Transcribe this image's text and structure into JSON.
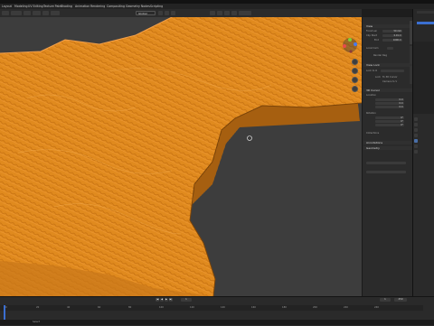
{
  "window_title": "",
  "menu": {
    "items": [
      "Layout",
      "Modeling",
      "UV Editing",
      "Texture Paint",
      "Shading",
      "Animation",
      "Rendering",
      "Compositing",
      "Geometry Nodes",
      "Scripting"
    ]
  },
  "header": {
    "mode_select": "Global"
  },
  "npanel": {
    "sections": {
      "view": "View",
      "focal_length": "Focal Len",
      "clip_start": "Clip Start",
      "clip_end": "End",
      "local_camera": "Local Cam",
      "render_region": "Render Reg",
      "view_lock": "View Lock",
      "lock_to_object": "Lock to O",
      "lock": "Lock",
      "lock_3d_cursor": "To 3D Cursor",
      "lock_camera": "Camera to V",
      "cursor_3d": "3D Cursor",
      "location": "Location",
      "rotation": "Rotation",
      "collections": "Collections",
      "annotations": "Annotations",
      "geometry": "Geometry"
    },
    "values": {
      "focal_length": "50 mm",
      "clip_start": "0.01 m",
      "clip_end": "1000 m",
      "cursor_x": "0 m",
      "cursor_y": "0 m",
      "cursor_z": "0 m",
      "rot_x": "0°",
      "rot_y": "0°",
      "rot_z": "0°"
    }
  },
  "timeline": {
    "ticks": [
      "0",
      "20",
      "40",
      "60",
      "80",
      "100",
      "120",
      "140",
      "160",
      "180",
      "200",
      "220",
      "240"
    ],
    "start": "1",
    "end": "250",
    "current": "1"
  },
  "statusbar": {
    "text": "Select"
  },
  "colors": {
    "terrain": "#e08a1e",
    "terrain_dark": "#a65c0a",
    "viewport_bg": "#3d3d3d",
    "panel_bg": "#2b2b2b",
    "accent_blue": "#3b6fd1",
    "gizmo_red": "#e84a4a",
    "gizmo_green": "#7fcf3a",
    "gizmo_blue": "#4a7ae8"
  }
}
